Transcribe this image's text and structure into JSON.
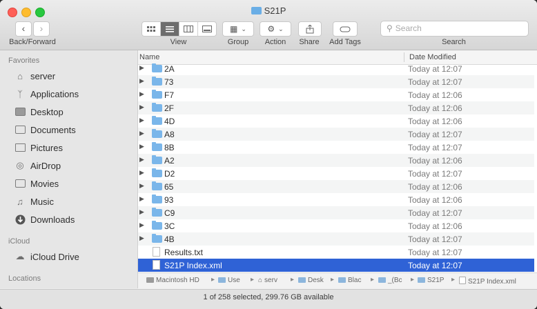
{
  "window": {
    "title": "S21P"
  },
  "toolbar": {
    "back_forward_label": "Back/Forward",
    "view_label": "View",
    "group_label": "Group",
    "action_label": "Action",
    "share_label": "Share",
    "add_tags_label": "Add Tags",
    "search_label": "Search",
    "search_placeholder": "Search"
  },
  "sidebar": {
    "favorites_header": "Favorites",
    "favorites": [
      {
        "label": "server",
        "icon": "home-icon"
      },
      {
        "label": "Applications",
        "icon": "applications-icon"
      },
      {
        "label": "Desktop",
        "icon": "desktop-icon"
      },
      {
        "label": "Documents",
        "icon": "documents-icon"
      },
      {
        "label": "Pictures",
        "icon": "pictures-icon"
      },
      {
        "label": "AirDrop",
        "icon": "airdrop-icon"
      },
      {
        "label": "Movies",
        "icon": "movies-icon"
      },
      {
        "label": "Music",
        "icon": "music-icon"
      },
      {
        "label": "Downloads",
        "icon": "downloads-icon"
      }
    ],
    "icloud_header": "iCloud",
    "icloud": [
      {
        "label": "iCloud Drive",
        "icon": "cloud-icon"
      }
    ],
    "locations_header": "Locations"
  },
  "list": {
    "columns": {
      "name": "Name",
      "date": "Date Modified"
    },
    "rows": [
      {
        "name": "2A",
        "date": "Today at 12:07",
        "type": "folder"
      },
      {
        "name": "73",
        "date": "Today at 12:07",
        "type": "folder"
      },
      {
        "name": "F7",
        "date": "Today at 12:06",
        "type": "folder"
      },
      {
        "name": "2F",
        "date": "Today at 12:06",
        "type": "folder"
      },
      {
        "name": "4D",
        "date": "Today at 12:06",
        "type": "folder"
      },
      {
        "name": "A8",
        "date": "Today at 12:07",
        "type": "folder"
      },
      {
        "name": "8B",
        "date": "Today at 12:07",
        "type": "folder"
      },
      {
        "name": "A2",
        "date": "Today at 12:06",
        "type": "folder"
      },
      {
        "name": "D2",
        "date": "Today at 12:07",
        "type": "folder"
      },
      {
        "name": "65",
        "date": "Today at 12:06",
        "type": "folder"
      },
      {
        "name": "93",
        "date": "Today at 12:06",
        "type": "folder"
      },
      {
        "name": "C9",
        "date": "Today at 12:07",
        "type": "folder"
      },
      {
        "name": "3C",
        "date": "Today at 12:06",
        "type": "folder"
      },
      {
        "name": "4B",
        "date": "Today at 12:07",
        "type": "folder"
      },
      {
        "name": "Results.txt",
        "date": "Today at 12:07",
        "type": "file"
      },
      {
        "name": "S21P Index.xml",
        "date": "Today at 12:07",
        "type": "file",
        "selected": true
      }
    ]
  },
  "pathbar": {
    "segments": [
      "Macintosh HD",
      "Use",
      "serv",
      "Desk",
      "Blac",
      "_(Bc",
      "S21P",
      "S21P Index.xml"
    ]
  },
  "status": {
    "text": "1 of 258 selected, 299.76 GB available"
  },
  "colors": {
    "selection": "#2f62d6",
    "folder": "#7ab6ea"
  }
}
